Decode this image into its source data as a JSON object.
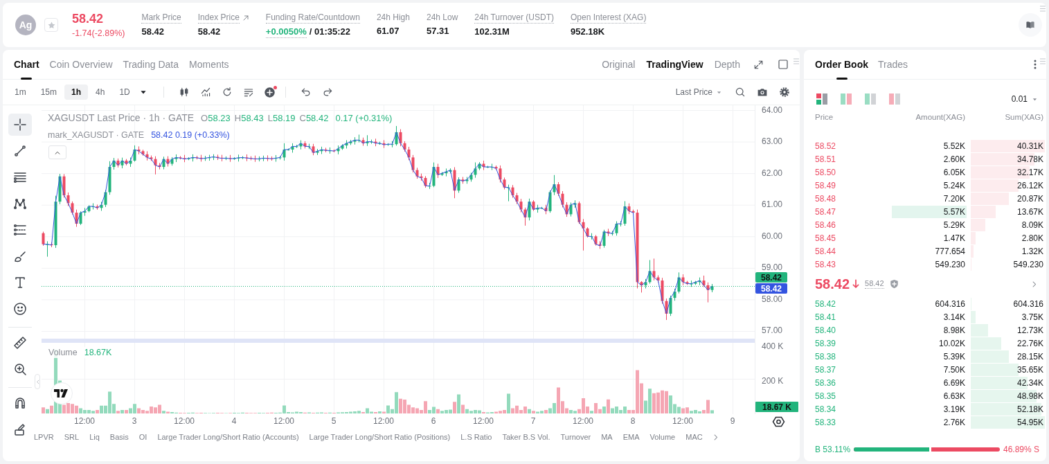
{
  "header": {
    "coin_logo": "Ag",
    "favorite": false,
    "price": {
      "kind": "down",
      "value": "58.42",
      "change": "-1.74(-2.89%)"
    },
    "stats": [
      {
        "kind": "plain",
        "label": "Mark Price",
        "value": "58.42",
        "underlined": true
      },
      {
        "kind": "link",
        "label": "Index Price",
        "value": "58.42",
        "underlined": true
      },
      {
        "kind": "funding",
        "label": "Funding Rate/Countdown",
        "rate": "+0.0050%",
        "countdown": "/ 01:35:22",
        "underlined": true
      },
      {
        "kind": "plain",
        "label": "24h High",
        "value": "61.07",
        "underlined": false
      },
      {
        "kind": "plain",
        "label": "24h Low",
        "value": "57.31",
        "underlined": false
      },
      {
        "kind": "plain",
        "label": "24h Turnover (USDT)",
        "value": "102.31M",
        "underlined": true
      },
      {
        "kind": "plain",
        "label": "Open Interest (XAG)",
        "value": "952.18K",
        "underlined": true
      }
    ]
  },
  "chart_panel": {
    "tabs": [
      {
        "label": "Chart",
        "selected": true
      },
      {
        "label": "Coin Overview",
        "selected": false
      },
      {
        "label": "Trading Data",
        "selected": false
      },
      {
        "label": "Moments",
        "selected": false
      }
    ],
    "views": [
      {
        "label": "Original",
        "selected": false
      },
      {
        "label": "TradingView",
        "selected": true
      },
      {
        "label": "Depth",
        "selected": false
      }
    ],
    "intervals": [
      {
        "label": "1m",
        "selected": false
      },
      {
        "label": "15m",
        "selected": false
      },
      {
        "label": "1h",
        "selected": true
      },
      {
        "label": "4h",
        "selected": false
      },
      {
        "label": "1D",
        "selected": false
      }
    ],
    "alert_dot": true,
    "price_source": "Last Price",
    "drawing_tools": [
      {
        "selected": true
      },
      {
        "selected": false
      },
      {
        "selected": false
      },
      {
        "selected": false
      },
      {
        "selected": false
      },
      {
        "selected": false
      },
      {
        "selected": false
      },
      {
        "selected": false
      },
      {
        "selected": false
      },
      {
        "selected": false
      },
      {
        "selected": false
      },
      {
        "selected": false
      }
    ],
    "legend": {
      "title": "XAGUSDT Last Price · 1h · GATE",
      "ohlc": [
        {
          "key": "O",
          "value": "58.23"
        },
        {
          "key": "H",
          "value": "58.43"
        },
        {
          "key": "L",
          "value": "58.19"
        },
        {
          "key": "C",
          "value": "58.42"
        }
      ],
      "change": "0.17 (+0.31%)"
    },
    "mark_legend": {
      "title": "mark_XAGUSDT · GATE",
      "values": "58.42 0.19 (+0.33%)"
    },
    "price_axis": [
      "64.00",
      "63.00",
      "62.00",
      "61.00",
      "60.00",
      "59.00",
      "58.00",
      "57.00"
    ],
    "price_tags": [
      {
        "kind": "last",
        "text": "58.42"
      },
      {
        "kind": "mark",
        "text": "58.42"
      }
    ],
    "volume_legend": {
      "label": "Volume",
      "value": "18.67K"
    },
    "volume_axis": [
      "400 K",
      "200 K"
    ],
    "volume_tag": "18.67 K",
    "time_axis": [
      "12:00",
      "3",
      "12:00",
      "4",
      "12:00",
      "5",
      "12:00",
      "6",
      "12:00",
      "7",
      "12:00",
      "8",
      "12:00",
      "9"
    ],
    "indicators": [
      "LPVR",
      "SRL",
      "Liq",
      "Basis",
      "OI",
      "Large Trader Long/Short Ratio (Accounts)",
      "Large Trader Long/Short Ratio (Positions)",
      "L.S Ratio",
      "Taker B.S Vol.",
      "Turnover",
      "MA",
      "EMA",
      "Volume",
      "MAC"
    ]
  },
  "order_book": {
    "tabs": [
      {
        "label": "Order Book",
        "selected": true
      },
      {
        "label": "Trades",
        "selected": false
      }
    ],
    "layouts": [
      {
        "selected": true
      },
      {
        "selected": false
      },
      {
        "selected": false
      },
      {
        "selected": false
      }
    ],
    "precision": "0.01",
    "columns": [
      "Price",
      "Amount(XAG)",
      "Sum(XAG)"
    ],
    "asks": [
      {
        "price": "58.52",
        "amount": "5.52K",
        "sum": "40.31K",
        "highlighted": false
      },
      {
        "price": "58.51",
        "amount": "2.60K",
        "sum": "34.78K",
        "highlighted": false
      },
      {
        "price": "58.50",
        "amount": "6.05K",
        "sum": "32.17K",
        "highlighted": false
      },
      {
        "price": "58.49",
        "amount": "5.24K",
        "sum": "26.12K",
        "highlighted": false
      },
      {
        "price": "58.48",
        "amount": "7.20K",
        "sum": "20.87K",
        "highlighted": false
      },
      {
        "price": "58.47",
        "amount": "5.57K",
        "sum": "13.67K",
        "highlighted": true
      },
      {
        "price": "58.46",
        "amount": "5.29K",
        "sum": "8.09K",
        "highlighted": false
      },
      {
        "price": "58.45",
        "amount": "1.47K",
        "sum": "2.80K",
        "highlighted": false
      },
      {
        "price": "58.44",
        "amount": "777.654",
        "sum": "1.32K",
        "highlighted": false
      },
      {
        "price": "58.43",
        "amount": "549.230",
        "sum": "549.230",
        "highlighted": false
      }
    ],
    "mid": {
      "kind": "down",
      "price": "58.42",
      "mark": "58.42"
    },
    "bids": [
      {
        "price": "58.42",
        "amount": "604.316",
        "sum": "604.316",
        "highlighted": false
      },
      {
        "price": "58.41",
        "amount": "3.14K",
        "sum": "3.75K",
        "highlighted": false
      },
      {
        "price": "58.40",
        "amount": "8.98K",
        "sum": "12.73K",
        "highlighted": false
      },
      {
        "price": "58.39",
        "amount": "10.02K",
        "sum": "22.76K",
        "highlighted": false
      },
      {
        "price": "58.38",
        "amount": "5.39K",
        "sum": "28.15K",
        "highlighted": false
      },
      {
        "price": "58.37",
        "amount": "7.50K",
        "sum": "35.65K",
        "highlighted": false
      },
      {
        "price": "58.36",
        "amount": "6.69K",
        "sum": "42.34K",
        "highlighted": false
      },
      {
        "price": "58.35",
        "amount": "6.63K",
        "sum": "48.98K",
        "highlighted": false
      },
      {
        "price": "58.34",
        "amount": "3.19K",
        "sum": "52.18K",
        "highlighted": false
      },
      {
        "price": "58.33",
        "amount": "2.76K",
        "sum": "54.95K",
        "highlighted": false
      }
    ],
    "ratio": {
      "buy": "B 53.11%",
      "sell": "46.89% S",
      "level": 0.5311
    }
  }
}
